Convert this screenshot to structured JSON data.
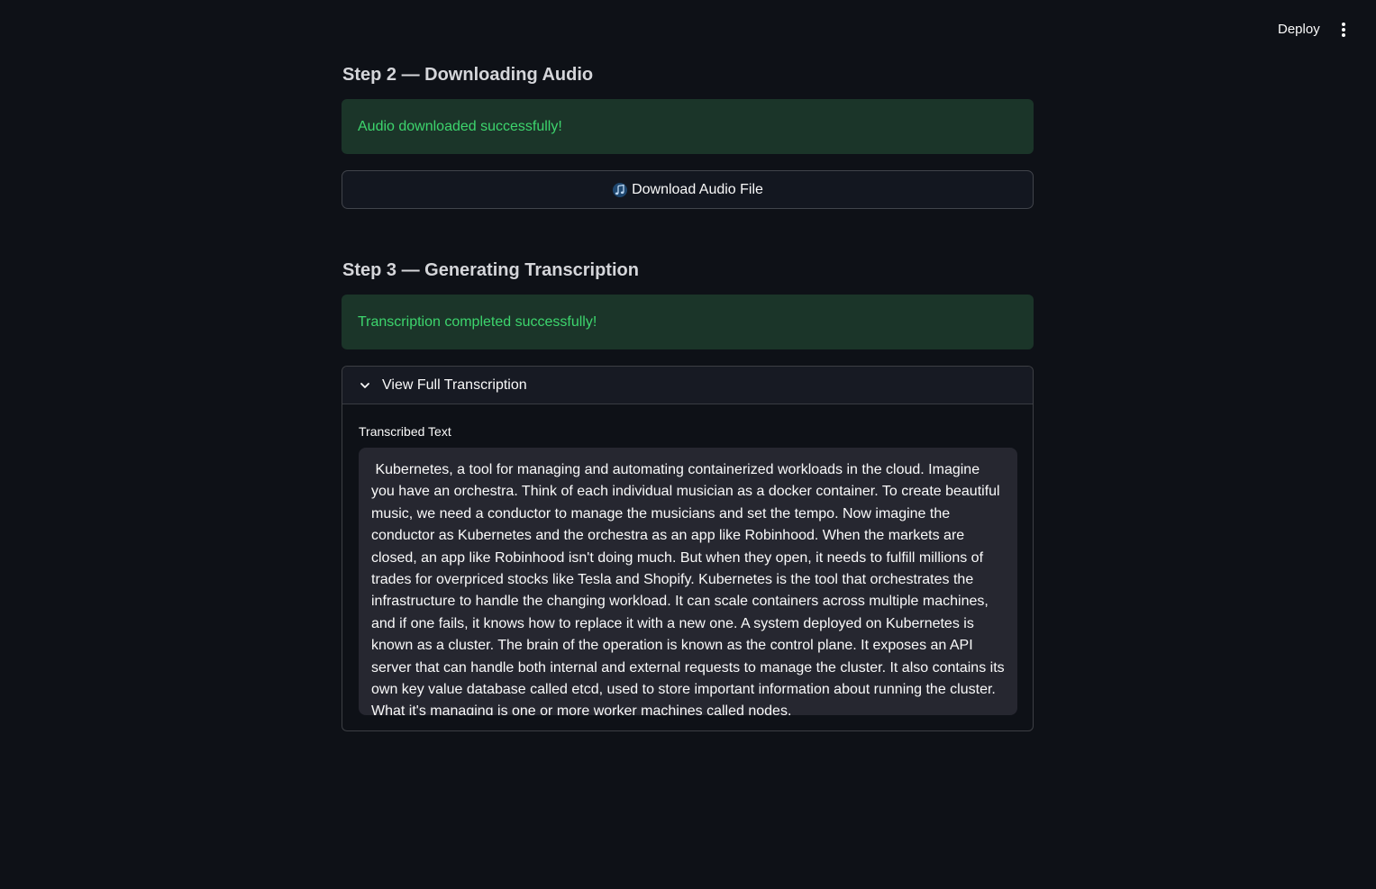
{
  "header": {
    "deploy_label": "Deploy",
    "menu_icon": "vertical-ellipsis-icon"
  },
  "step2": {
    "heading": "Step 2 — Downloading Audio",
    "success_message": "Audio downloaded successfully!",
    "download_button_label": "Download Audio File",
    "download_button_icon": "music-note-icon"
  },
  "step3": {
    "heading": "Step 3 — Generating Transcription",
    "success_message": "Transcription completed successfully!",
    "expander": {
      "title": "View Full Transcription",
      "icon": "chevron-down-icon",
      "field_label": "Transcribed Text",
      "text": " Kubernetes, a tool for managing and automating containerized workloads in the cloud. Imagine you have an orchestra. Think of each individual musician as a docker container. To create beautiful music, we need a conductor to manage the musicians and set the tempo. Now imagine the conductor as Kubernetes and the orchestra as an app like Robinhood. When the markets are closed, an app like Robinhood isn't doing much. But when they open, it needs to fulfill millions of trades for overpriced stocks like Tesla and Shopify. Kubernetes is the tool that orchestrates the infrastructure to handle the changing workload. It can scale containers across multiple machines, and if one fails, it knows how to replace it with a new one. A system deployed on Kubernetes is known as a cluster. The brain of the operation is known as the control plane. It exposes an API server that can handle both internal and external requests to manage the cluster. It also contains its own key value database called etcd, used to store important information about running the cluster. What it's managing is one or more worker machines called nodes."
    }
  },
  "colors": {
    "background": "#0e1117",
    "success_bg": "#1b3529",
    "success_text": "#3dd56d",
    "textarea_bg": "#262730"
  }
}
